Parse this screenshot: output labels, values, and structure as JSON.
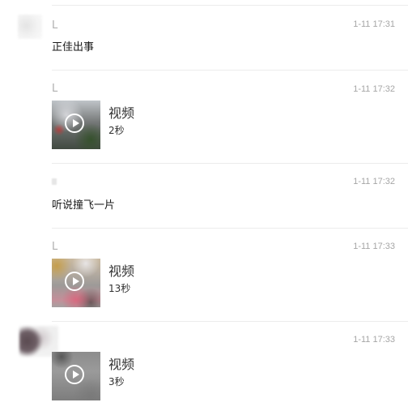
{
  "messages": [
    {
      "sender": "L",
      "time": "1-11 17:31",
      "text": "正佳出事"
    },
    {
      "sender": "L",
      "time": "1-11 17:32",
      "video": {
        "title": "视频",
        "duration": "2秒"
      }
    },
    {
      "sender": "",
      "time": "1-11 17:32",
      "text": "听说撞飞一片"
    },
    {
      "sender": "L",
      "time": "1-11 17:33",
      "video": {
        "title": "视频",
        "duration": "13秒"
      }
    },
    {
      "sender": "",
      "time": "1-11 17:33",
      "video": {
        "title": "视频",
        "duration": "3秒"
      }
    }
  ],
  "icons": {
    "play": "play-circle-icon"
  },
  "colors": {
    "timestamp": "#a6a6a6",
    "sender": "#b0b0b0",
    "divider": "#ececec"
  }
}
